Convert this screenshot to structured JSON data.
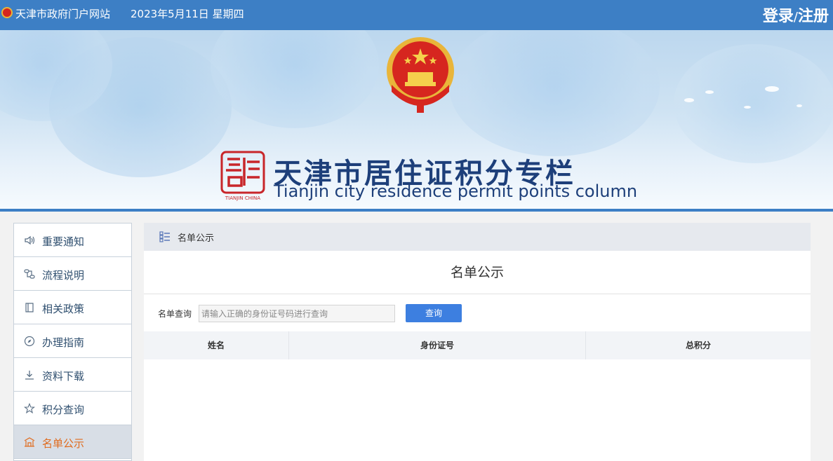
{
  "topbar": {
    "site_name": "天津市政府门户网站",
    "date": "2023年5月11日 星期四",
    "login": "登录",
    "separator": "/",
    "register": "注册"
  },
  "banner": {
    "title_cn": "天津市居住证积分专栏",
    "title_en": "Tianjin city residence permit points column",
    "seal_text": "TIANJIN CHINA"
  },
  "sidebar": {
    "items": [
      {
        "label": "重要通知",
        "icon": "speaker-icon"
      },
      {
        "label": "流程说明",
        "icon": "flow-icon"
      },
      {
        "label": "相关政策",
        "icon": "book-icon"
      },
      {
        "label": "办理指南",
        "icon": "compass-icon"
      },
      {
        "label": "资料下载",
        "icon": "download-icon"
      },
      {
        "label": "积分查询",
        "icon": "star-icon"
      },
      {
        "label": "名单公示",
        "icon": "building-icon",
        "active": true
      }
    ]
  },
  "content": {
    "breadcrumb": "名单公示",
    "title": "名单公示",
    "search_label": "名单查询",
    "search_placeholder": "请输入正确的身份证号码进行查询",
    "search_button": "查询",
    "columns": [
      "姓名",
      "身份证号",
      "总积分"
    ]
  },
  "colors": {
    "topbar": "#3d7fc5",
    "title": "#1d3f7a",
    "active": "#e06c1f",
    "button": "#3d7fe0"
  }
}
